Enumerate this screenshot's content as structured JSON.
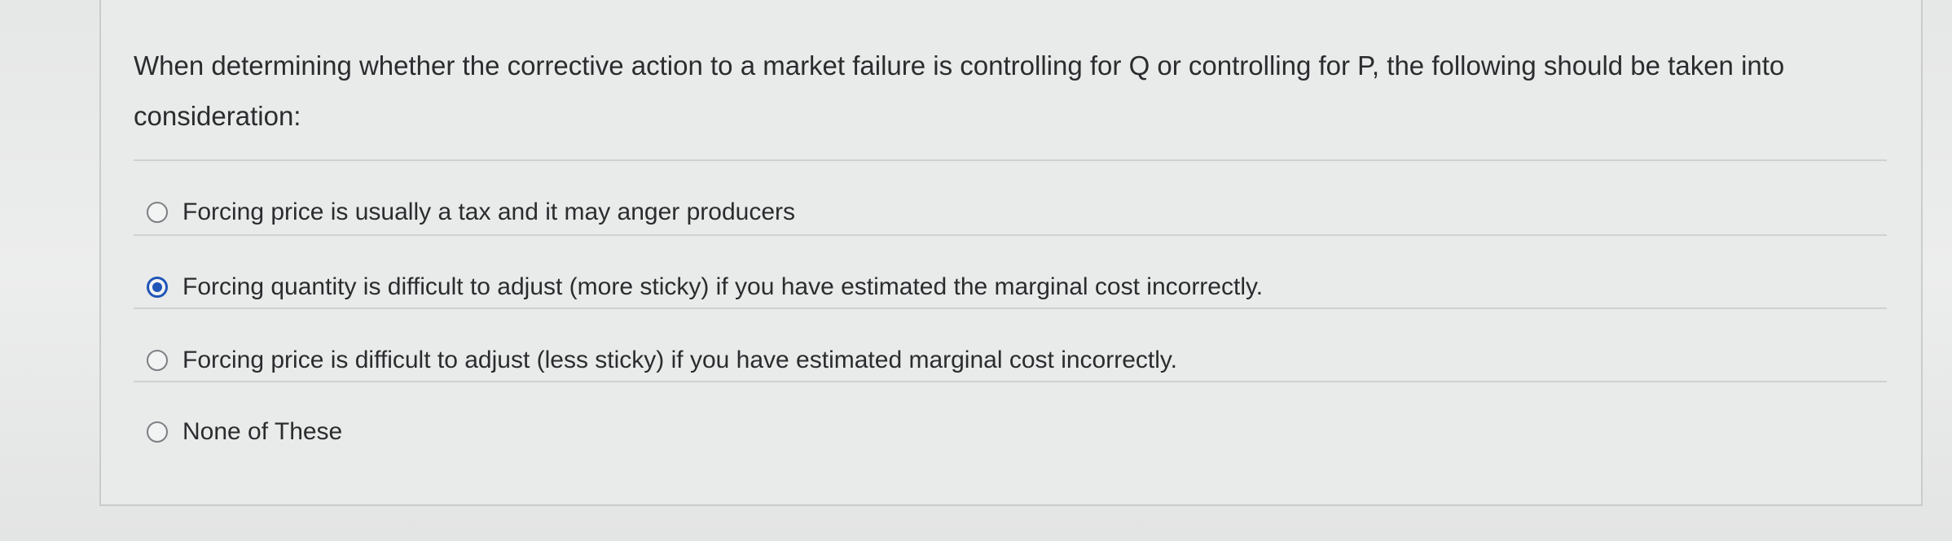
{
  "question": {
    "text": "When determining whether the corrective action to a market failure is controlling for Q or controlling for P, the following should be taken into consideration:"
  },
  "options": [
    {
      "label": "Forcing price is usually a tax and it may anger producers",
      "selected": false
    },
    {
      "label": "Forcing quantity is difficult to adjust (more sticky) if you have estimated the marginal cost incorrectly.",
      "selected": true
    },
    {
      "label": "Forcing price is difficult to adjust (less sticky) if you have estimated marginal cost incorrectly.",
      "selected": false
    },
    {
      "label": "None of These",
      "selected": false
    }
  ],
  "colors": {
    "selected_radio": "#1f55b8",
    "text": "#2a2c2e",
    "background": "#e9eaea"
  }
}
